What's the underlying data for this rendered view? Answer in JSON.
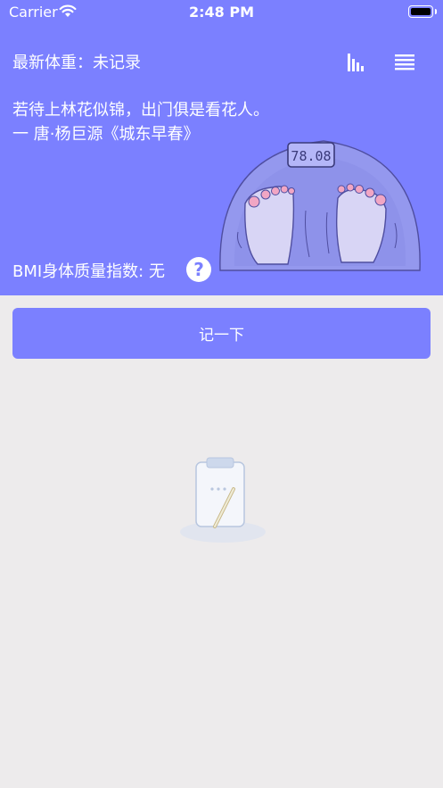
{
  "status_bar": {
    "carrier": "Carrier",
    "time": "2:48 PM"
  },
  "header": {
    "latest_weight": "最新体重：未记录",
    "poem_line1": "若待上林花似锦，出门俱是看花人。",
    "poem_line2": "一 唐·杨巨源《城东早春》",
    "scale_display": "78.08",
    "bmi_text": "BMI身体质量指数: 无",
    "help_symbol": "?"
  },
  "actions": {
    "record_label": "记一下"
  },
  "colors": {
    "accent": "#7b80ff",
    "background": "#edebec"
  },
  "icons": [
    "wifi-icon",
    "battery-icon",
    "chart-icon",
    "menu-icon",
    "help-icon",
    "scale-illustration",
    "clipboard-illustration"
  ]
}
